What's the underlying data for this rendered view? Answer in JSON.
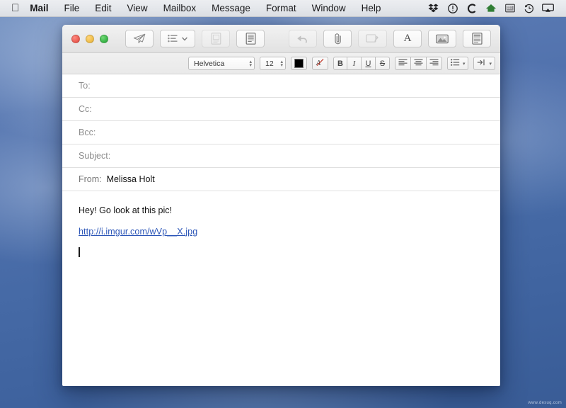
{
  "menubar": {
    "apple_icon": "apple-logo-icon",
    "items": [
      {
        "label": "Mail",
        "bold": true
      },
      {
        "label": "File",
        "bold": false
      },
      {
        "label": "Edit",
        "bold": false
      },
      {
        "label": "View",
        "bold": false
      },
      {
        "label": "Mailbox",
        "bold": false
      },
      {
        "label": "Message",
        "bold": false
      },
      {
        "label": "Format",
        "bold": false
      },
      {
        "label": "Window",
        "bold": false
      },
      {
        "label": "Help",
        "bold": false
      }
    ],
    "status_icons": [
      "dropbox-icon",
      "alert-circle-icon",
      "crashplan-c-icon",
      "green-house-icon",
      "calendar-grid-icon",
      "time-machine-clock-icon",
      "airplay-icon"
    ]
  },
  "window": {
    "traffic_lights": {
      "close": "close-button",
      "minimize": "minimize-button",
      "zoom": "zoom-button"
    },
    "toolbar_left": [
      {
        "name": "send-button",
        "icon": "paper-plane-icon",
        "disabled": false
      },
      {
        "name": "header-fields-button",
        "icon": "list-chevron-icon",
        "disabled": false
      },
      {
        "name": "photo-browser-stationery-button",
        "icon": "document-photo-icon",
        "disabled": true
      },
      {
        "name": "stationery-button",
        "icon": "document-lines-icon",
        "disabled": false
      }
    ],
    "toolbar_right": [
      {
        "name": "undo-button",
        "icon": "undo-arrow-icon",
        "disabled": true
      },
      {
        "name": "attach-button",
        "icon": "paperclip-icon",
        "disabled": false
      },
      {
        "name": "markup-button",
        "icon": "markup-pen-icon",
        "disabled": true
      },
      {
        "name": "format-button",
        "icon": "letter-a-icon",
        "disabled": false,
        "label": "A"
      },
      {
        "name": "photo-browser-button",
        "icon": "photo-image-icon",
        "disabled": false
      },
      {
        "name": "stationery-picker-button",
        "icon": "stationery-page-icon",
        "disabled": false
      }
    ]
  },
  "formatbar": {
    "font_family": "Helvetica",
    "font_size": "12",
    "text_color": "#000000",
    "clear_formatting": "A",
    "bold": "B",
    "italic": "I",
    "underline": "U",
    "strikethrough": "S",
    "align_left": "align-left-icon",
    "align_center": "align-center-icon",
    "align_right": "align-right-icon",
    "list_menu": "list-icon",
    "indent_menu": "indent-icon"
  },
  "fields": [
    {
      "label": "To:",
      "value": "",
      "name": "to-field"
    },
    {
      "label": "Cc:",
      "value": "",
      "name": "cc-field"
    },
    {
      "label": "Bcc:",
      "value": "",
      "name": "bcc-field"
    },
    {
      "label": "Subject:",
      "value": "",
      "name": "subject-field"
    },
    {
      "label": "From:",
      "value": "Melissa Holt",
      "name": "from-field"
    }
  ],
  "message_body": {
    "greeting": "Hey! Go look at this pic!",
    "link": "http://i.imgur.com/wVp__X.jpg"
  },
  "watermark": "www.desuq.com"
}
